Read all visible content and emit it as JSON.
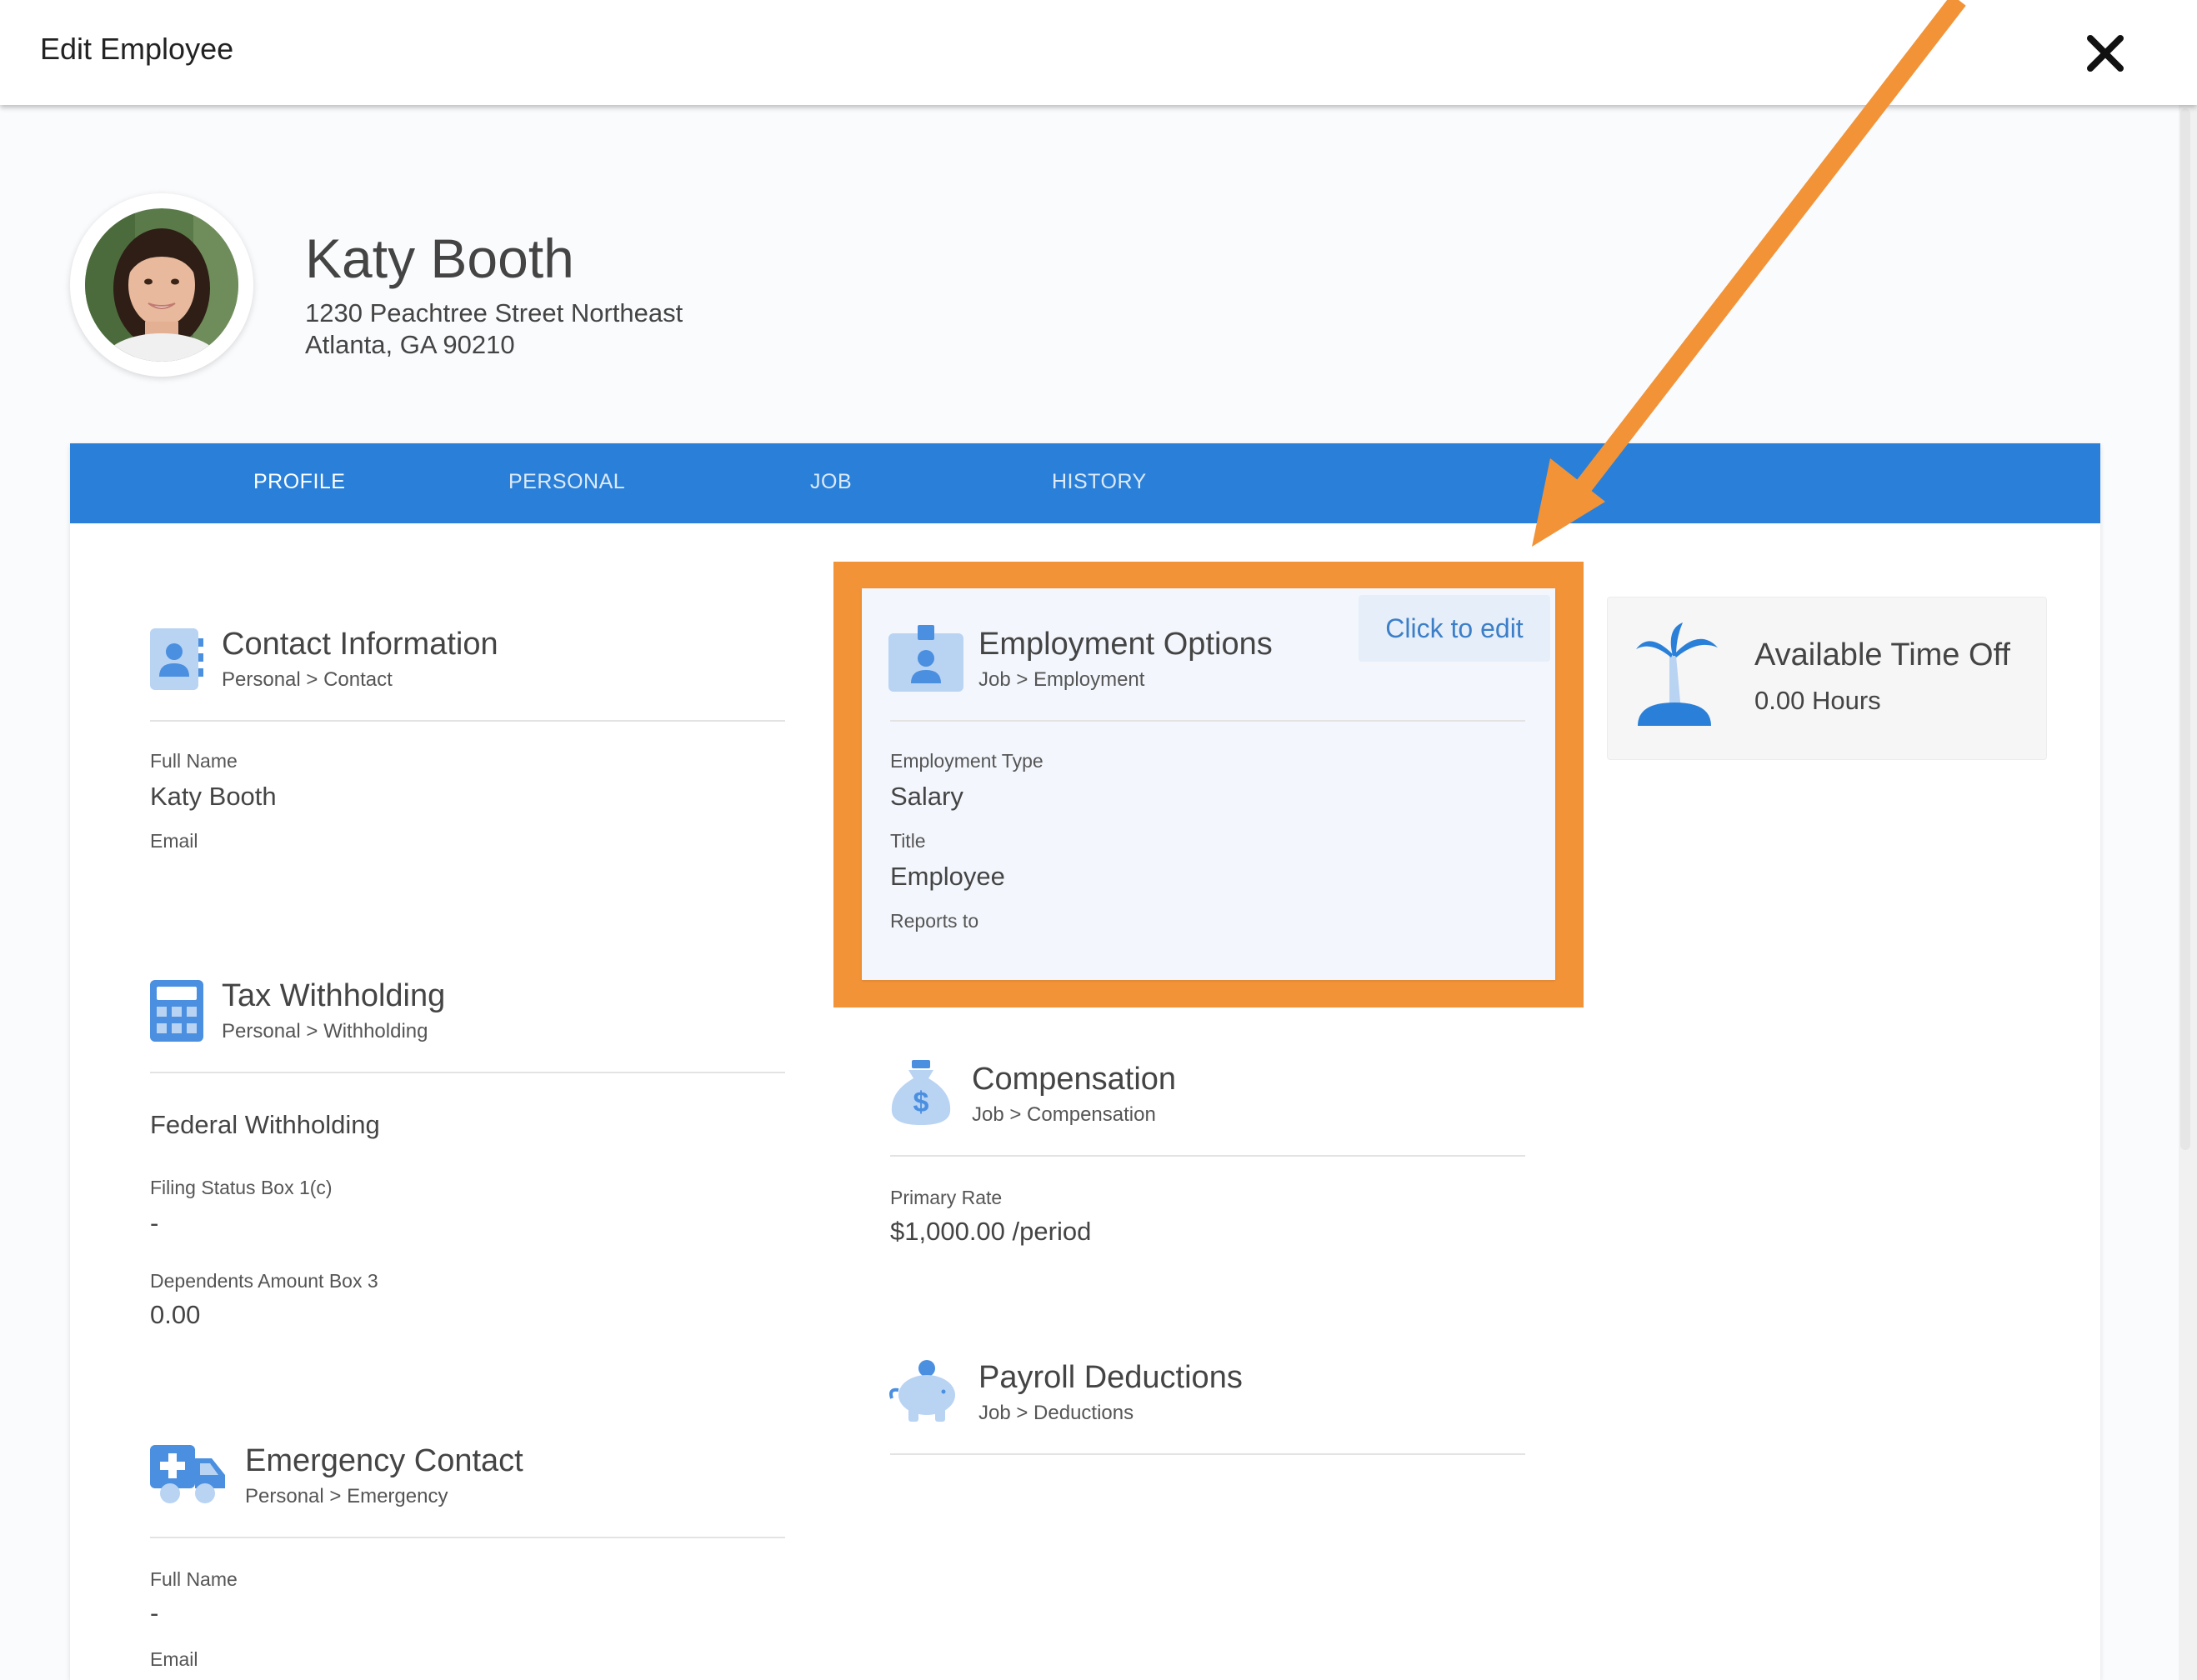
{
  "window": {
    "title": "Edit Employee"
  },
  "employee": {
    "name": "Katy Booth",
    "address_line1": "1230 Peachtree Street Northeast",
    "address_line2": "Atlanta, GA 90210"
  },
  "tabs": [
    {
      "label": "PROFILE",
      "active": true
    },
    {
      "label": "PERSONAL",
      "active": false
    },
    {
      "label": "JOB",
      "active": false
    },
    {
      "label": "HISTORY",
      "active": false
    }
  ],
  "contact": {
    "title": "Contact Information",
    "sub": "Personal > Contact",
    "full_name_label": "Full Name",
    "full_name": "Katy Booth",
    "email_label": "Email"
  },
  "tax": {
    "title": "Tax Withholding",
    "sub": "Personal > Withholding",
    "section": "Federal Withholding",
    "filing_label": "Filing Status Box 1(c)",
    "filing_value": "-",
    "dependents_label": "Dependents Amount Box 3",
    "dependents_value": "0.00"
  },
  "emergency": {
    "title": "Emergency Contact",
    "sub": "Personal > Emergency",
    "full_name_label": "Full Name",
    "full_name": "-",
    "email_label": "Email"
  },
  "employment": {
    "title": "Employment Options",
    "sub": "Job > Employment",
    "edit_label": "Click to edit",
    "type_label": "Employment Type",
    "type_value": "Salary",
    "title_label": "Title",
    "title_value": "Employee",
    "reports_label": "Reports to"
  },
  "compensation": {
    "title": "Compensation",
    "sub": "Job > Compensation",
    "rate_label": "Primary Rate",
    "rate_value": "$1,000.00 /period"
  },
  "deductions": {
    "title": "Payroll Deductions",
    "sub": "Job > Deductions"
  },
  "timeoff": {
    "title": "Available Time Off",
    "value": "0.00 Hours"
  },
  "colors": {
    "accent": "#2a80d8",
    "highlight": "#f29338",
    "icon_blue": "#4a8fe0",
    "icon_light": "#b9d3f3"
  }
}
